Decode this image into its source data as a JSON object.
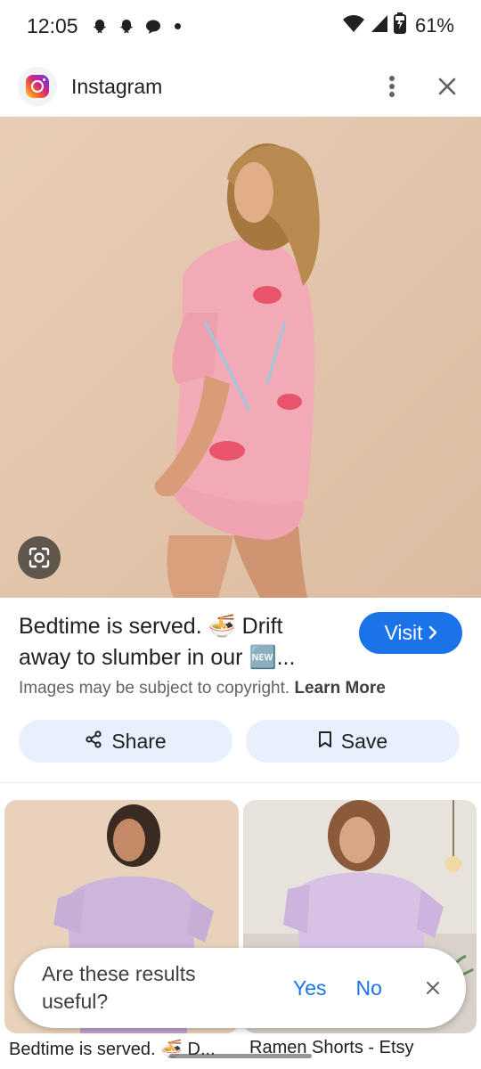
{
  "status_bar": {
    "time": "12:05",
    "battery": "61%",
    "icons": [
      "snapchat-icon",
      "snapchat-icon",
      "chat-icon",
      "dot-icon",
      "wifi-icon",
      "signal-icon",
      "battery-icon"
    ]
  },
  "header": {
    "source_name": "Instagram",
    "icons": [
      "instagram-logo",
      "more-vert-icon",
      "close-icon"
    ]
  },
  "caption": {
    "text": "Bedtime is served. 🍜 Drift away to slumber in our 🆕...",
    "copyright_notice": "Images may be subject to copyright.",
    "learn_more": "Learn More"
  },
  "buttons": {
    "visit": "Visit",
    "share": "Share",
    "save": "Save"
  },
  "results": [
    {
      "title": "Bedtime is served. 🍜 D..."
    },
    {
      "title": "Ramen Shorts - Etsy"
    }
  ],
  "feedback": {
    "question": "Are these results useful?",
    "yes": "Yes",
    "no": "No"
  },
  "colors": {
    "accent": "#1a73e8",
    "tonal_button": "#e8f0fe",
    "image_bg": "#e3c7ae"
  }
}
